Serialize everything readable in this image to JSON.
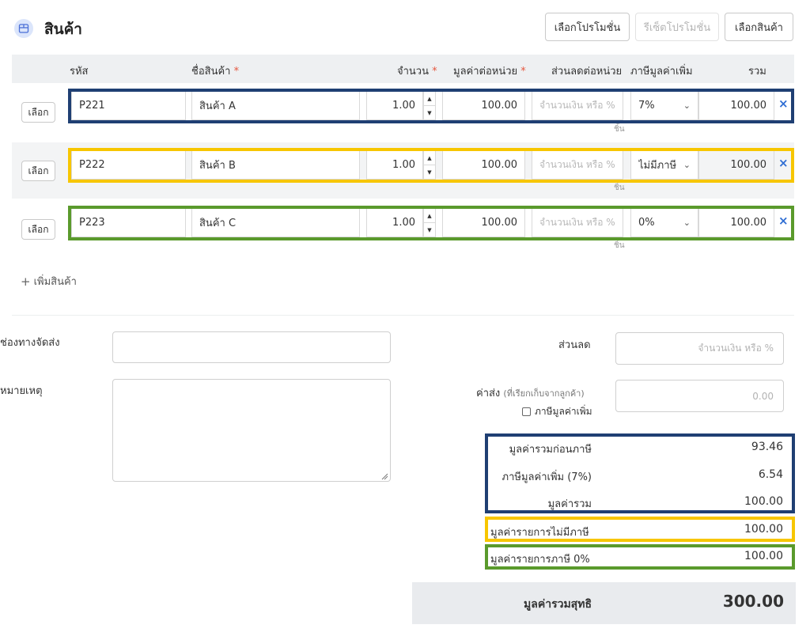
{
  "header": {
    "title": "สินค้า",
    "icon": "box-icon",
    "buttons": {
      "select_promotion": "เลือกโปรโมชั่น",
      "reset_promotion": "รีเซ็ตโปรโมชั่น",
      "select_product": "เลือกสินค้า"
    }
  },
  "table": {
    "columns": {
      "code": "รหัส",
      "name": "ชื่อสินค้า",
      "qty": "จำนวน",
      "unit_price": "มูลค่าต่อหน่วย",
      "discount": "ส่วนลดต่อหน่วย",
      "vat": "ภาษีมูลค่าเพิ่ม",
      "total": "รวม",
      "required_mark": "*"
    },
    "select_label": "เลือก",
    "discount_placeholder": "จำนวนเงิน หรือ %",
    "unit_label": "ชิ้น",
    "remove_glyph": "×",
    "rows": [
      {
        "code": "P221",
        "name": "สินค้า A",
        "qty": "1.00",
        "unit_price": "100.00",
        "vat": "7%",
        "total": "100.00",
        "highlight": "#1f3f73"
      },
      {
        "code": "P222",
        "name": "สินค้า B",
        "qty": "1.00",
        "unit_price": "100.00",
        "vat": "ไม่มีภาษี",
        "total": "100.00",
        "highlight": "#f7c600"
      },
      {
        "code": "P223",
        "name": "สินค้า C",
        "qty": "1.00",
        "unit_price": "100.00",
        "vat": "0%",
        "total": "100.00",
        "highlight": "#5a9a2c"
      }
    ]
  },
  "add_product": {
    "icon": "plus-icon",
    "label": "เพิ่มสินค้า"
  },
  "footer": {
    "shipping_channel_label": "ช่องทางจัดส่ง",
    "note_label": "หมายเหตุ",
    "discount_label": "ส่วนลด",
    "discount_placeholder": "จำนวนเงิน หรือ %",
    "shipping_fee_label": "ค่าส่ง",
    "shipping_fee_note": "(ที่เรียกเก็บจากลูกค้า)",
    "shipping_fee_placeholder": "0.00",
    "vat_checkbox_label": "ภาษีมูลค่าเพิ่ม"
  },
  "summary": {
    "pre_vat_label": "มูลค่ารวมก่อนภาษี",
    "pre_vat_value": "93.46",
    "vat_label": "ภาษีมูลค่าเพิ่ม (7%)",
    "vat_value": "6.54",
    "total_label": "มูลค่ารวม",
    "total_value": "100.00",
    "non_vat_label": "มูลค่ารายการไม่มีภาษี",
    "non_vat_value": "100.00",
    "zero_vat_label": "มูลค่ารายการภาษี 0%",
    "zero_vat_value": "100.00",
    "net_label": "มูลค่ารวมสุทธิ",
    "net_value": "300.00"
  },
  "colors": {
    "blue_frame": "#1f3f73",
    "yellow_frame": "#f7c600",
    "green_frame": "#5a9a2c",
    "accent": "#2e6dd3"
  }
}
